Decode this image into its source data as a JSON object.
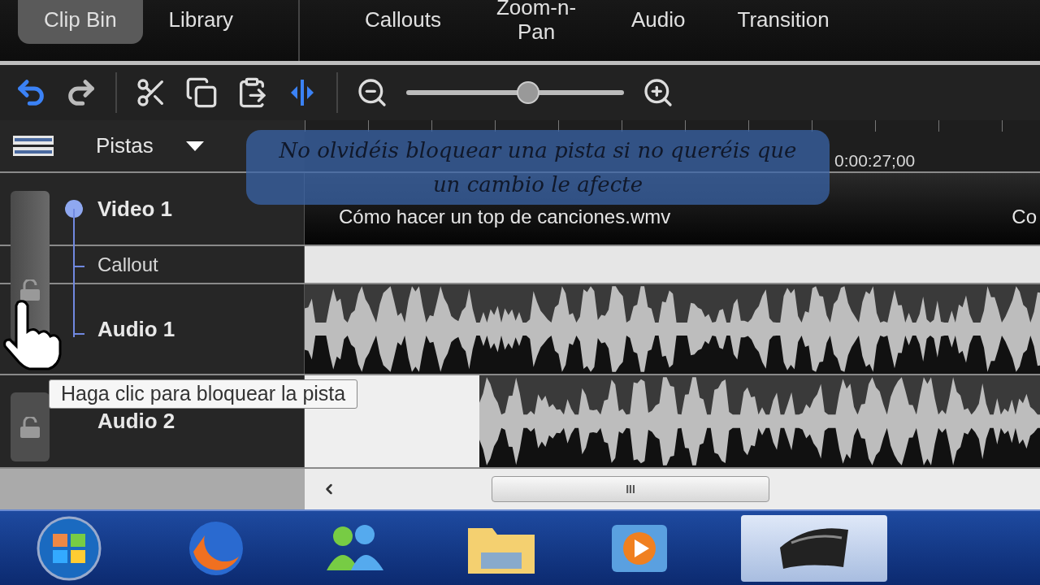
{
  "tabs": [
    {
      "label": "Clip Bin",
      "selected": true
    },
    {
      "label": "Library",
      "selected": false
    },
    {
      "label": "Callouts",
      "selected": false
    },
    {
      "label": "Zoom-n-Pan",
      "selected": false
    },
    {
      "label": "Audio",
      "selected": false
    },
    {
      "label": "Transition",
      "selected": false
    }
  ],
  "zoom_slider": {
    "level": 0.56
  },
  "timeline": {
    "tracks_menu": "Pistas",
    "ruler": [
      "0:00:27;00"
    ],
    "tracks": [
      {
        "name": "Video 1",
        "kind": "video",
        "clips": [
          "Cómo hacer un top de canciones.wmv",
          "Co"
        ]
      },
      {
        "name": "Callout",
        "kind": "callout"
      },
      {
        "name": "Audio 1",
        "kind": "audio"
      },
      {
        "name": "Audio 2",
        "kind": "audio"
      }
    ]
  },
  "callout": "No olvidéis bloquear una pista si no queréis que un cambio le afecte",
  "tooltip": "Haga clic para bloquear la pista",
  "scrollbar": {
    "grip": "III"
  }
}
